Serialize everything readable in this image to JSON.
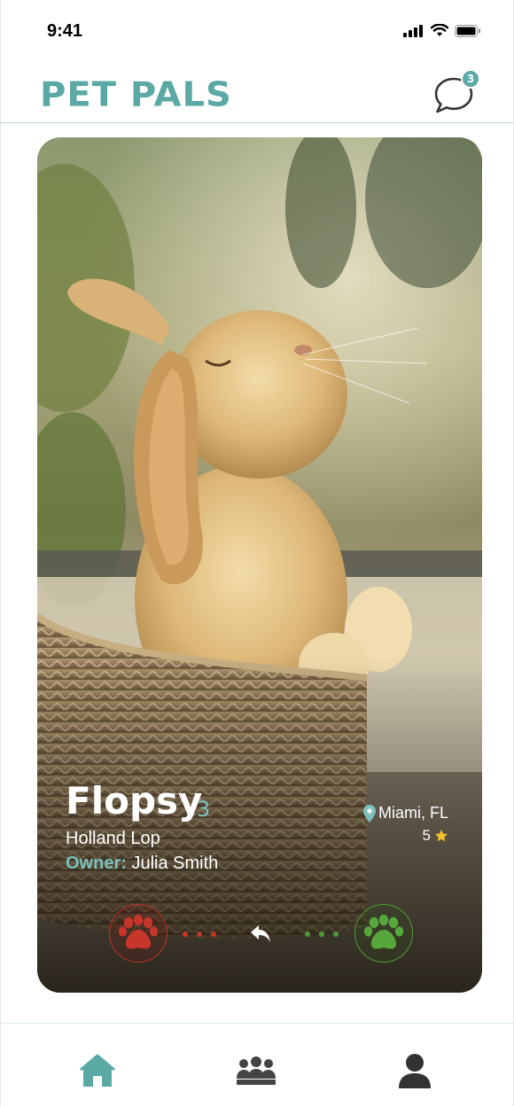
{
  "status_bar": {
    "time": "9:41",
    "signal_icon": "signal-icon",
    "wifi_icon": "wifi-icon",
    "battery_icon": "battery-icon"
  },
  "header": {
    "title": "PET PALS",
    "chat_icon": "chat-bubble-icon",
    "unread_count": "3"
  },
  "pet": {
    "name": "Flopsy",
    "age": "3",
    "breed": "Holland Lop",
    "owner_label": "Owner:",
    "owner_name": "Julia Smith",
    "location": "Miami, FL",
    "rating": "5",
    "photo_icon": "rabbit-photo"
  },
  "actions": {
    "pass_icon": "paw-icon",
    "undo_icon": "undo-icon",
    "like_icon": "paw-icon"
  },
  "bottom_nav": {
    "items": [
      {
        "icon": "home-icon"
      },
      {
        "icon": "group-icon"
      },
      {
        "icon": "profile-icon"
      }
    ]
  },
  "colors": {
    "brand": "#5aa9a5",
    "pass": "#b8322a",
    "like": "#4e9c36",
    "star": "#f2c12e"
  }
}
